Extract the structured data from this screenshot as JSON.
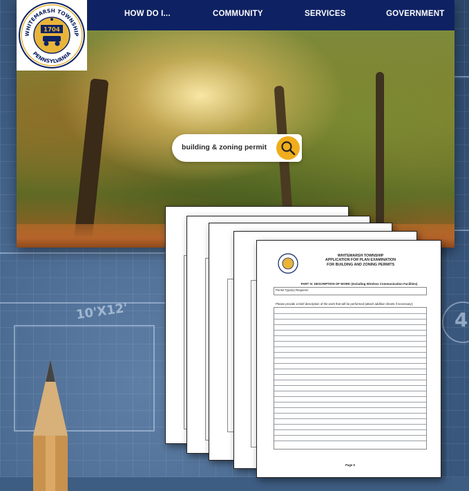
{
  "navbar": {
    "items": [
      "HOW DO I...",
      "COMMUNITY",
      "SERVICES",
      "GOVERNMENT"
    ],
    "background": "#0e2263"
  },
  "seal": {
    "top_text": "WHITEMARSH TOWNSHIP",
    "bottom_text": "PENNSYLVANIA",
    "year": "1704",
    "gold": "#e8b53a"
  },
  "search": {
    "query": "building & zoning permit",
    "button_color": "#f0ad1c",
    "icon": "search-icon"
  },
  "blueprint": {
    "dimension_label": "10'X12'",
    "circle_label": "4"
  },
  "form": {
    "title_lines": [
      "WHITEMARSH TOWNSHIP",
      "APPLICATION FOR PLAN EXAMINATION",
      "FOR BUILDING AND ZONING PERMITS"
    ],
    "part_heading": "PART IV. DESCRIPTION OF WORK (Including Wireless Communication Facilities)",
    "permit_types": "Permit Type(s) Required:",
    "instruction": "Please provide a brief description of the work that will be performed (attach addition sheets if necessary):",
    "page_label": "Page 5"
  }
}
